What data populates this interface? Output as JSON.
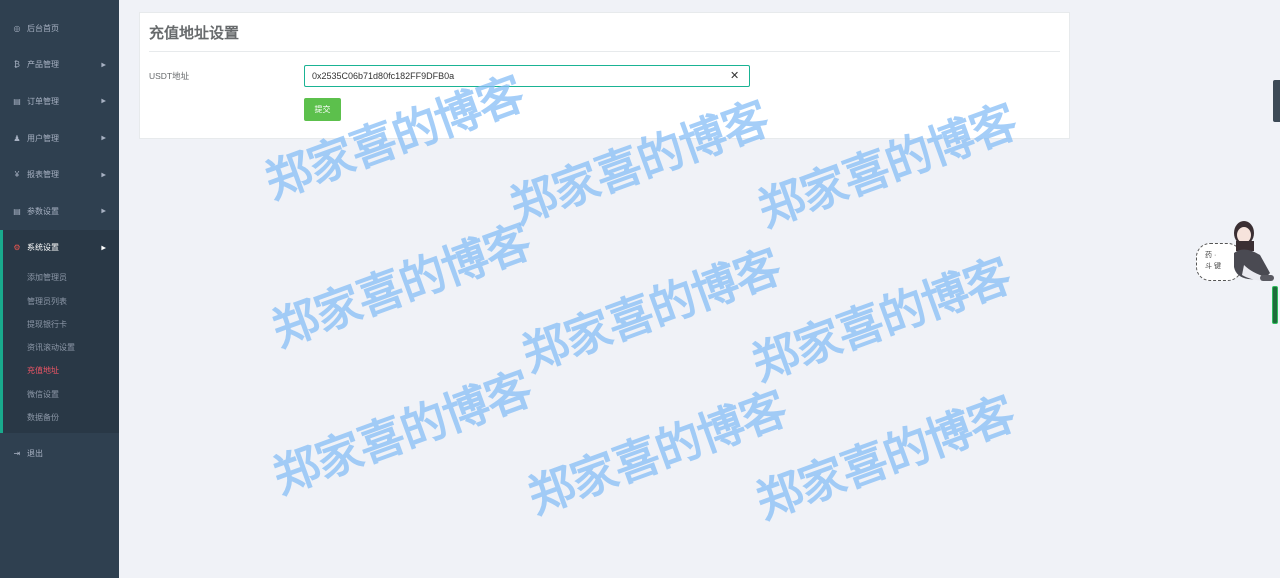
{
  "sidebar": {
    "items": [
      {
        "label": "后台首页",
        "icon": "dashboard-icon",
        "glyph": "◎"
      },
      {
        "label": "产品管理",
        "icon": "bitcoin-icon",
        "glyph": "₿"
      },
      {
        "label": "订单管理",
        "icon": "copy-icon",
        "glyph": "▤"
      },
      {
        "label": "用户管理",
        "icon": "user-icon",
        "glyph": "♟"
      },
      {
        "label": "报表管理",
        "icon": "yen-icon",
        "glyph": "¥"
      },
      {
        "label": "参数设置",
        "icon": "copy-icon",
        "glyph": "▤"
      }
    ],
    "active": {
      "label": "系统设置",
      "icon": "gears-icon",
      "glyph": "⚙",
      "sub_items": [
        "添加管理员",
        "管理员列表",
        "提现银行卡",
        "资讯滚动设置",
        "充值地址",
        "微信设置",
        "数据备份"
      ],
      "current_index": 4
    },
    "logout": {
      "label": "退出",
      "icon": "sign-out-icon",
      "glyph": "⇥"
    }
  },
  "card": {
    "title": "充值地址设置",
    "field_label": "USDT地址",
    "usdt_value": "0x2535C06b71d80fc182FF9DFB0a",
    "clear_glyph": "✕",
    "submit_label": "提交"
  },
  "watermark": {
    "text": "郑家喜的博客",
    "color": "#87bef5"
  },
  "mascot": {
    "bubble_line1": "药 ·",
    "bubble_line2": "斗 键"
  },
  "colors": {
    "sidebar_bg": "#2f4050",
    "accent_green": "#1ab394",
    "button_green": "#5cc04c",
    "current_red": "#ed5565"
  }
}
